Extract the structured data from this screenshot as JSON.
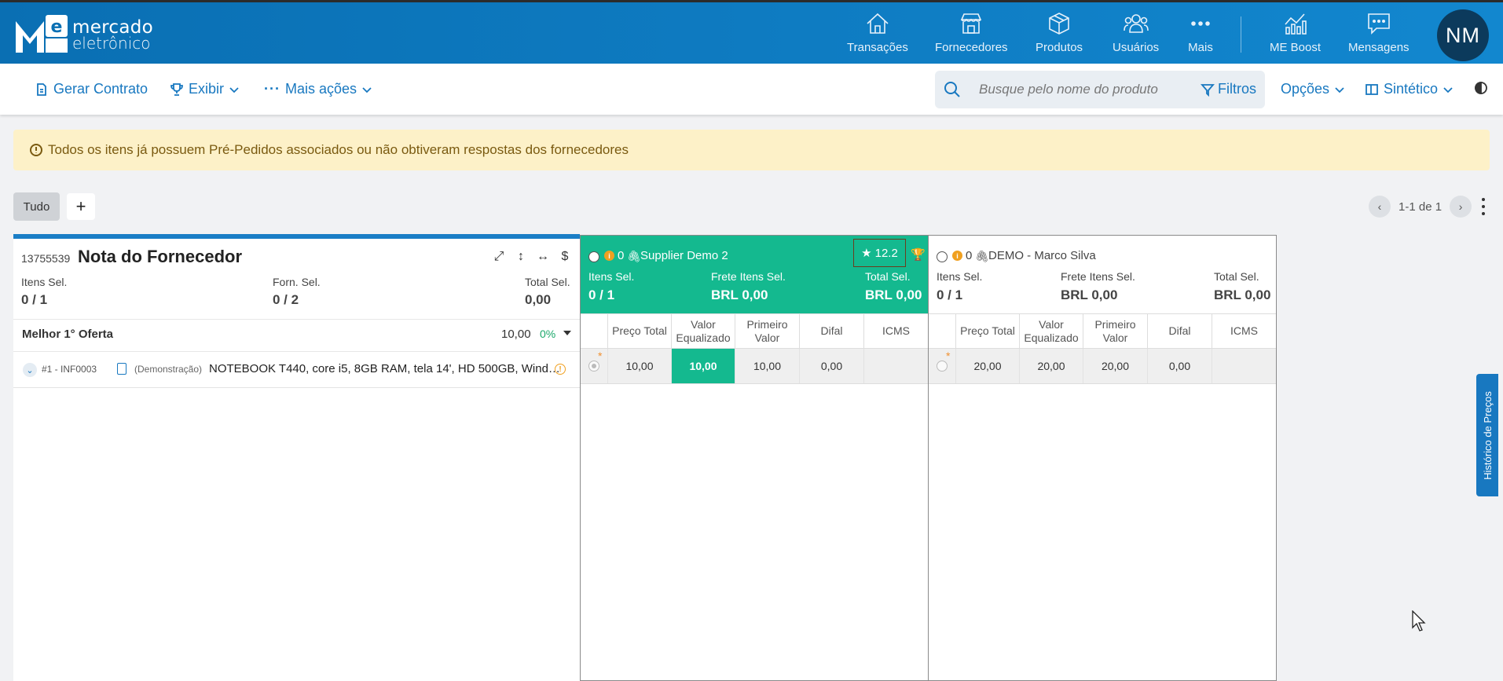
{
  "brand": {
    "line1": "mercado",
    "line2": "eletrônico"
  },
  "nav": [
    "Transações",
    "Fornecedores",
    "Produtos",
    "Usuários",
    "Mais",
    "ME Boost",
    "Mensagens"
  ],
  "user": {
    "initials": "NM"
  },
  "toolbar": {
    "gerar_contrato": "Gerar Contrato",
    "exibir": "Exibir",
    "mais_acoes": "Mais ações",
    "search_placeholder": "Busque pelo nome do produto",
    "filtros": "Filtros",
    "opcoes": "Opções",
    "sintetico": "Sintético"
  },
  "alert": "Todos os itens já possuem Pré-Pedidos associados ou não obtiveram respostas dos fornecedores",
  "tabs": {
    "tudo": "Tudo",
    "add": "+"
  },
  "pager": {
    "text": "1-1 de 1"
  },
  "left": {
    "id": "13755539",
    "title": "Nota do Fornecedor",
    "labels": {
      "itens": "Itens Sel.",
      "forn": "Forn. Sel.",
      "total": "Total Sel."
    },
    "values": {
      "itens": "0 / 1",
      "forn": "0 / 2",
      "total": "0,00"
    },
    "best": {
      "label": "Melhor 1° Oferta",
      "value": "10,00",
      "pct": "0%"
    },
    "item": {
      "code": "#1 - INF0003",
      "tag": "(Demonstração)",
      "desc": "NOTEBOOK T440, core i5, 8GB RAM, tela 14', HD 500GB, Windows"
    }
  },
  "suppliers": [
    {
      "count": "0",
      "name": "Supplier Demo 2",
      "score": "12.2",
      "labels": {
        "itens": "Itens Sel.",
        "frete": "Frete Itens Sel.",
        "total": "Total Sel."
      },
      "values": {
        "itens": "0 / 1",
        "frete": "BRL 0,00",
        "total": "BRL 0,00"
      },
      "cols": [
        "Preço Total",
        "Valor Equalizado",
        "Primeiro Valor",
        "Difal",
        "ICMS"
      ],
      "row": [
        "10,00",
        "10,00",
        "10,00",
        "0,00",
        ""
      ]
    },
    {
      "count": "0",
      "name": "DEMO - Marco Silva",
      "labels": {
        "itens": "Itens Sel.",
        "frete": "Frete Itens Sel.",
        "total": "Total Sel."
      },
      "values": {
        "itens": "0 / 1",
        "frete": "BRL 0,00",
        "total": "BRL 0,00"
      },
      "cols": [
        "Preço Total",
        "Valor Equalizado",
        "Primeiro Valor",
        "Difal",
        "ICMS"
      ],
      "row": [
        "20,00",
        "20,00",
        "20,00",
        "0,00",
        ""
      ]
    }
  ],
  "side_tab": "Histórico de Preços"
}
